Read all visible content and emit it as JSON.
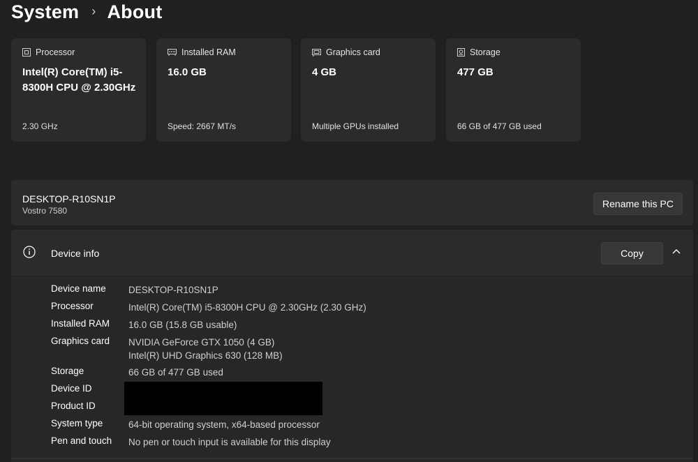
{
  "breadcrumb": {
    "parent": "System",
    "separator": "›",
    "current": "About"
  },
  "cards": [
    {
      "id": "processor",
      "label": "Processor",
      "icon": "processor-icon",
      "main": "Intel(R) Core(TM) i5-8300H CPU @ 2.30GHz",
      "sub": "2.30 GHz"
    },
    {
      "id": "ram",
      "label": "Installed RAM",
      "icon": "ram-icon",
      "main": "16.0 GB",
      "sub": "Speed: 2667 MT/s"
    },
    {
      "id": "graphics",
      "label": "Graphics card",
      "icon": "graphics-card-icon",
      "main": "4 GB",
      "sub": "Multiple GPUs installed"
    },
    {
      "id": "storage",
      "label": "Storage",
      "icon": "storage-icon",
      "main": "477 GB",
      "sub": "66 GB of 477 GB used"
    }
  ],
  "device": {
    "name": "DESKTOP-R10SN1P",
    "model": "Vostro 7580",
    "rename_label": "Rename this PC"
  },
  "device_info": {
    "title": "Device info",
    "copy_label": "Copy",
    "rows": [
      {
        "label": "Device name",
        "value": "DESKTOP-R10SN1P"
      },
      {
        "label": "Processor",
        "value": "Intel(R) Core(TM) i5-8300H CPU @ 2.30GHz (2.30 GHz)"
      },
      {
        "label": "Installed RAM",
        "value": "16.0 GB (15.8 GB usable)"
      },
      {
        "label": "Graphics card",
        "value": "NVIDIA GeForce GTX 1050 (4 GB)",
        "value2": "Intel(R) UHD Graphics 630 (128 MB)"
      },
      {
        "label": "Storage",
        "value": "66 GB of 477 GB used"
      },
      {
        "label": "Device ID",
        "value": ""
      },
      {
        "label": "Product ID",
        "value": ""
      },
      {
        "label": "System type",
        "value": "64-bit operating system, x64-based processor"
      },
      {
        "label": "Pen and touch",
        "value": "No pen or touch input is available for this display"
      }
    ]
  },
  "colors": {
    "background": "#202020",
    "card": "#2b2b2b",
    "redaction": "#000000"
  }
}
